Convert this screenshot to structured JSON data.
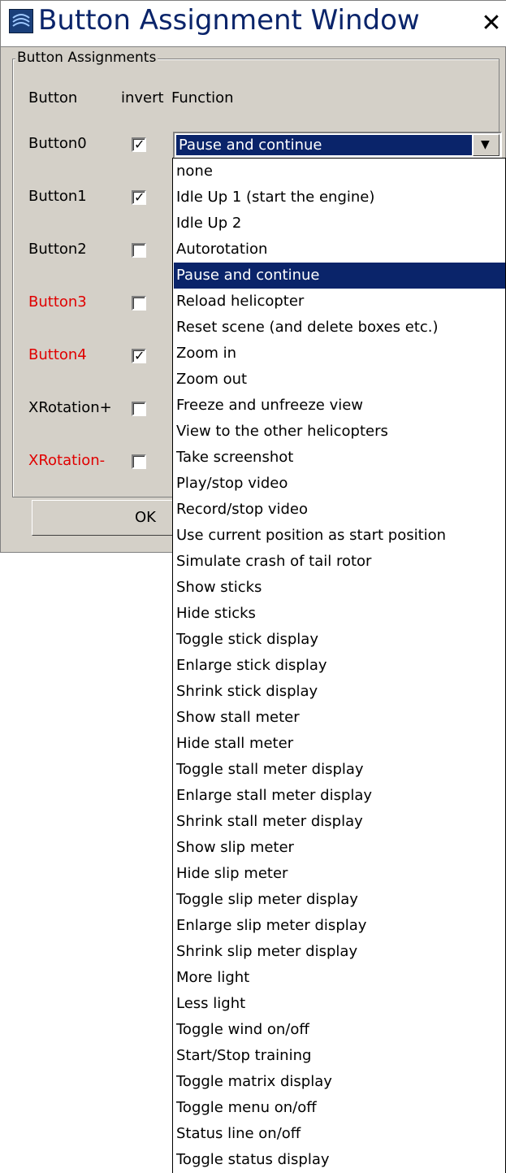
{
  "window": {
    "title": "Button Assignment Window"
  },
  "group": {
    "legend": "Button Assignments"
  },
  "headers": {
    "button": "Button",
    "invert": "invert",
    "function": "Function"
  },
  "rows": [
    {
      "label": "Button0",
      "inverted": true,
      "red": false
    },
    {
      "label": "Button1",
      "inverted": true,
      "red": false
    },
    {
      "label": "Button2",
      "inverted": false,
      "red": false
    },
    {
      "label": "Button3",
      "inverted": false,
      "red": true
    },
    {
      "label": "Button4",
      "inverted": true,
      "red": true
    },
    {
      "label": "XRotation+",
      "inverted": false,
      "red": false
    },
    {
      "label": "XRotation-",
      "inverted": false,
      "red": true
    }
  ],
  "combo": {
    "selected": "Pause and continue"
  },
  "ok_label": "OK",
  "colors": {
    "highlight": "#0a246a",
    "dialog": "#d4d0c8",
    "warning_label": "#e00000"
  },
  "dropdown": {
    "selected_index": 4,
    "items": [
      "none",
      "Idle Up 1 (start the engine)",
      "Idle Up 2",
      "Autorotation",
      "Pause and continue",
      "Reload helicopter",
      "Reset scene (and delete boxes etc.)",
      "Zoom in",
      "Zoom out",
      "Freeze and unfreeze view",
      "View to the other helicopters",
      "Take screenshot",
      "Play/stop video",
      "Record/stop video",
      "Use current position as start position",
      "Simulate crash of tail rotor",
      "Show sticks",
      "Hide sticks",
      "Toggle stick display",
      "Enlarge stick display",
      "Shrink stick display",
      "Show stall meter",
      "Hide stall meter",
      "Toggle stall meter display",
      "Enlarge stall meter display",
      "Shrink stall meter display",
      "Show slip meter",
      "Hide slip meter",
      "Toggle slip meter display",
      "Enlarge slip meter display",
      "Shrink slip meter display",
      "More light",
      "Less light",
      "Toggle wind on/off",
      "Start/Stop training",
      "Toggle matrix display",
      "Toggle menu on/off",
      "Status line on/off",
      "Toggle status display"
    ]
  }
}
